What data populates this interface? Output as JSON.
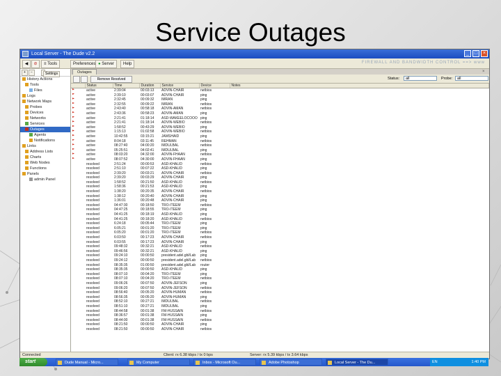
{
  "slide_title": "Service Outages",
  "window": {
    "title": "Local Server - The Dude v2.2",
    "brand": "FIREWALL AND BANDWIDTH CONTROL ==> www"
  },
  "toolbar": {
    "tools_label": "Tools",
    "settings_label": "Settings",
    "preferences_label": "Preferences",
    "server_label": "Server",
    "help_label": "Help"
  },
  "sidebar": {
    "items": [
      {
        "label": "History Actions"
      },
      {
        "label": "Tools"
      },
      {
        "label": "Files"
      },
      {
        "label": "Logs"
      },
      {
        "label": "Network Maps"
      },
      {
        "label": "Probes"
      },
      {
        "label": "Devices"
      },
      {
        "label": "Networks"
      },
      {
        "label": "Services"
      },
      {
        "label": "Outages"
      },
      {
        "label": "Agents"
      },
      {
        "label": "Notifications"
      },
      {
        "label": "Links"
      },
      {
        "label": "Address Lists"
      },
      {
        "label": "Charts"
      },
      {
        "label": "Web Nodes"
      },
      {
        "label": "Functions"
      },
      {
        "label": "Panels"
      },
      {
        "label": "admin Panel"
      }
    ]
  },
  "tab": {
    "label": "Outages"
  },
  "filter": {
    "remove_resolved_label": "Remove Resolved",
    "status_label": "Status:",
    "status_value": "all",
    "probe_label": "Probe:",
    "probe_value": "all"
  },
  "table": {
    "columns": [
      "Status",
      "Time",
      "Duration",
      "Service",
      "Device",
      "Notes"
    ],
    "rows": [
      {
        "flag": true,
        "status": "active",
        "time": "2:39:04",
        "duration": "00:03:13",
        "service": "ADVIN-CHAIR",
        "device": "netbios"
      },
      {
        "flag": true,
        "status": "active",
        "time": "2:39:10",
        "duration": "00:03:07",
        "service": "ADVIN-CHAIR",
        "device": "ping"
      },
      {
        "flag": true,
        "status": "active",
        "time": "2:32:45",
        "duration": "00:09:32",
        "service": "IMRAN",
        "device": "ping"
      },
      {
        "flag": true,
        "status": "active",
        "time": "2:32:55",
        "duration": "00:09:22",
        "service": "IMRAN",
        "device": "netbios"
      },
      {
        "flag": true,
        "status": "active",
        "time": "2:43:40",
        "duration": "00:58:18",
        "service": "ADVIN-AMAN",
        "device": "netbios"
      },
      {
        "flag": true,
        "status": "active",
        "time": "2:43:36",
        "duration": "00:58:23",
        "service": "ADVIN-AMAN",
        "device": "ping"
      },
      {
        "flag": true,
        "status": "active",
        "time": "2:21:41",
        "duration": "01:18:14",
        "service": "ASD-WAKEELOCOOO",
        "device": "ping"
      },
      {
        "flag": true,
        "status": "active",
        "time": "2:21:41",
        "duration": "01:18:14",
        "service": "ADVIN-WEBIO",
        "device": "netbios"
      },
      {
        "flag": true,
        "status": "active",
        "time": "1:58:52",
        "duration": "00:43:29",
        "service": "ADVIN-WEBIO",
        "device": "ping"
      },
      {
        "flag": true,
        "status": "active",
        "time": "1:15:13",
        "duration": "01:02:58",
        "service": "ADVIN-WEBIO",
        "device": "netbios"
      },
      {
        "flag": true,
        "status": "active",
        "time": "10:42:55",
        "duration": "03:15:21",
        "service": "JAMSHAID",
        "device": "ping"
      },
      {
        "flag": true,
        "status": "active",
        "time": "8:04:18",
        "duration": "03:11:45",
        "service": "REHMAN",
        "device": "netbios"
      },
      {
        "flag": true,
        "status": "active",
        "time": "08:27:40",
        "duration": "04:00:20",
        "service": "IMDULBAL",
        "device": "netbios"
      },
      {
        "flag": true,
        "status": "active",
        "time": "05:25:51",
        "duration": "04:02:41",
        "service": "IMDULBAL",
        "device": "ping"
      },
      {
        "flag": true,
        "status": "active",
        "time": "08:03:20",
        "duration": "04:32:00",
        "service": "ADVIN-FHAAN",
        "device": "netbios"
      },
      {
        "flag": true,
        "status": "active",
        "time": "08:07:52",
        "duration": "04:30:00",
        "service": "ADVIN-FHAAN",
        "device": "ping"
      },
      {
        "flag": false,
        "status": "resolved",
        "time": "2:51:24",
        "duration": "00:00:53",
        "service": "ASD-KHALID",
        "device": "netbios"
      },
      {
        "flag": false,
        "status": "resolved",
        "time": "2:51:10",
        "duration": "00:07:22",
        "service": "ASD-KHALID",
        "device": "ping"
      },
      {
        "flag": false,
        "status": "resolved",
        "time": "2:39:20",
        "duration": "00:03:21",
        "service": "ADVIN-CHAIR",
        "device": "netbios"
      },
      {
        "flag": false,
        "status": "resolved",
        "time": "2:39:20",
        "duration": "00:03:29",
        "service": "ADVIN-CHAIR",
        "device": "ping"
      },
      {
        "flag": false,
        "status": "resolved",
        "time": "1:58:52",
        "duration": "00:21:50",
        "service": "ASD-KHALID",
        "device": "netbios"
      },
      {
        "flag": false,
        "status": "resolved",
        "time": "1:58:36",
        "duration": "00:21:53",
        "service": "ASD-KHALID",
        "device": "ping"
      },
      {
        "flag": false,
        "status": "resolved",
        "time": "1:38:20",
        "duration": "00:20:35",
        "service": "ADVIN-CHAIR",
        "device": "netbios"
      },
      {
        "flag": false,
        "status": "resolved",
        "time": "1:38:12",
        "duration": "00:20:40",
        "service": "ADVIN-CHAIR",
        "device": "ping"
      },
      {
        "flag": false,
        "status": "resolved",
        "time": "1:36:01",
        "duration": "00:20:48",
        "service": "ADVIN-CHAIR",
        "device": "ping"
      },
      {
        "flag": false,
        "status": "resolved",
        "time": "04:47:30",
        "duration": "00:18:50",
        "service": "TRO-ITEEM",
        "device": "netbios"
      },
      {
        "flag": false,
        "status": "resolved",
        "time": "04:47:25",
        "duration": "00:18:55",
        "service": "TRO-ITEEM",
        "device": "ping"
      },
      {
        "flag": false,
        "status": "resolved",
        "time": "04:41:25",
        "duration": "00:18:19",
        "service": "ASD-KHALID",
        "device": "ping"
      },
      {
        "flag": false,
        "status": "resolved",
        "time": "04:41:25",
        "duration": "00:18:20",
        "service": "ASD-KHALID",
        "device": "netbios"
      },
      {
        "flag": false,
        "status": "resolved",
        "time": "6:24:18",
        "duration": "00:05:44",
        "service": "TRO-ITEEM",
        "device": "ping"
      },
      {
        "flag": false,
        "status": "resolved",
        "time": "6:05:21",
        "duration": "00:01:20",
        "service": "TRO-ITEEM",
        "device": "ping"
      },
      {
        "flag": false,
        "status": "resolved",
        "time": "6:05:20",
        "duration": "00:01:20",
        "service": "TRO-ITEEM",
        "device": "netbios"
      },
      {
        "flag": false,
        "status": "resolved",
        "time": "6:03:50",
        "duration": "00:17:23",
        "service": "ADVIN-CHAIR",
        "device": "netbios"
      },
      {
        "flag": false,
        "status": "resolved",
        "time": "6:03:55",
        "duration": "00:17:23",
        "service": "ADVIN-CHAIR",
        "device": "ping"
      },
      {
        "flag": false,
        "status": "resolved",
        "time": "09:48:32",
        "duration": "00:32:21",
        "service": "ASD-KHALID",
        "device": "netbios"
      },
      {
        "flag": false,
        "status": "resolved",
        "time": "09:46:56",
        "duration": "00:32:21",
        "service": "ASD-KHALID",
        "device": "ping"
      },
      {
        "flag": false,
        "status": "resolved",
        "time": "09:24:10",
        "duration": "00:00:50",
        "service": "president.adel.gbl/Lab",
        "device": "ping"
      },
      {
        "flag": false,
        "status": "resolved",
        "time": "09:24:12",
        "duration": "00:00:50",
        "service": "president.adel.gbl/Lab",
        "device": "netbios"
      },
      {
        "flag": false,
        "status": "resolved",
        "time": "08:35:35",
        "duration": "01:00:50",
        "service": "president.adel.gbl/Lab",
        "device": "router"
      },
      {
        "flag": false,
        "status": "resolved",
        "time": "08:35:35",
        "duration": "00:00:50",
        "service": "ASD-KHALID",
        "device": "ping"
      },
      {
        "flag": false,
        "status": "resolved",
        "time": "08:07:10",
        "duration": "00:04:20",
        "service": "TRO-ITEEM",
        "device": "ping"
      },
      {
        "flag": false,
        "status": "resolved",
        "time": "08:07:10",
        "duration": "00:04:20",
        "service": "TRO-ITEEM",
        "device": "netbios"
      },
      {
        "flag": false,
        "status": "resolved",
        "time": "09:06:26",
        "duration": "00:07:50",
        "service": "ADVIN-JEFSON",
        "device": "ping"
      },
      {
        "flag": false,
        "status": "resolved",
        "time": "09:06:20",
        "duration": "00:07:50",
        "service": "ADVIN-JEFSON",
        "device": "netbios"
      },
      {
        "flag": false,
        "status": "resolved",
        "time": "08:56:40",
        "duration": "00:05:20",
        "service": "ADVIN-HUMAN",
        "device": "netbios"
      },
      {
        "flag": false,
        "status": "resolved",
        "time": "08:56:35",
        "duration": "00:05:20",
        "service": "ADVIN-HUMAN",
        "device": "ping"
      },
      {
        "flag": false,
        "status": "resolved",
        "time": "08:52:10",
        "duration": "00:27:21",
        "service": "IMDULBAL",
        "device": "netbios"
      },
      {
        "flag": false,
        "status": "resolved",
        "time": "08:51:10",
        "duration": "00:27:21",
        "service": "IMDULBAL",
        "device": "ping"
      },
      {
        "flag": false,
        "status": "resolved",
        "time": "08:44:58",
        "duration": "00:01:38",
        "service": "FM-HUSSAIN",
        "device": "netbios"
      },
      {
        "flag": false,
        "status": "resolved",
        "time": "08:36:57",
        "duration": "00:01:38",
        "service": "FM-HUSSAIN",
        "device": "ping"
      },
      {
        "flag": false,
        "status": "resolved",
        "time": "08:44:00",
        "duration": "00:01:38",
        "service": "FM-HUSSAIN",
        "device": "netbios"
      },
      {
        "flag": false,
        "status": "resolved",
        "time": "08:21:50",
        "duration": "00:00:50",
        "service": "ADVIN-CHAIR",
        "device": "ping"
      },
      {
        "flag": false,
        "status": "resolved",
        "time": "08:21:50",
        "duration": "00:00:50",
        "service": "ADVIN-CHAIR",
        "device": "netbios"
      }
    ]
  },
  "statusbar": {
    "left": "Connected",
    "client": "Client: rx 6.38 kbps / tx 0 bps",
    "server": "Server: rx 5.39 kbps / tx 3.64 kbps"
  },
  "taskbar": {
    "start_label": "start",
    "tasks": [
      {
        "label": "Dude Manual - Micro..."
      },
      {
        "label": "My Computer"
      },
      {
        "label": "Inbox - Microsoft Ou..."
      },
      {
        "label": "Adobe Photoshop"
      },
      {
        "label": "Local Server - The Du..."
      }
    ],
    "lang": "EN",
    "clock": "1:40 PM"
  }
}
